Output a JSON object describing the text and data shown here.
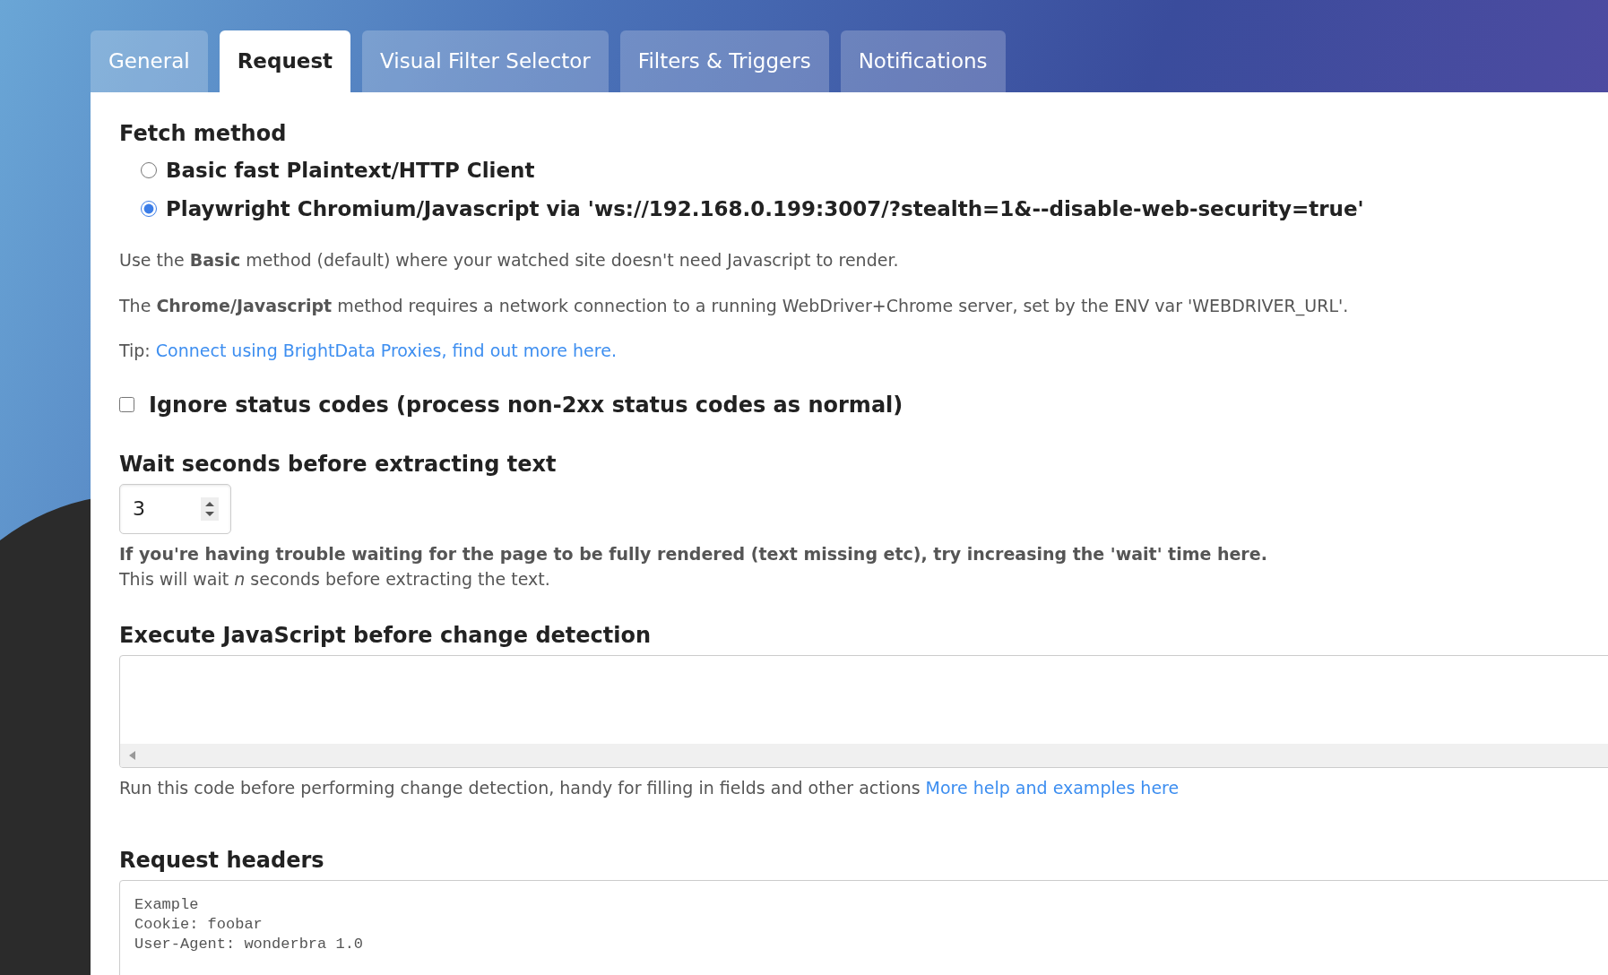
{
  "tabs": [
    {
      "label": "General",
      "selected": false
    },
    {
      "label": "Request",
      "selected": true
    },
    {
      "label": "Visual Filter Selector",
      "selected": false
    },
    {
      "label": "Filters & Triggers",
      "selected": false
    },
    {
      "label": "Notifications",
      "selected": false
    }
  ],
  "fetch_method": {
    "label": "Fetch method",
    "options": [
      {
        "label": "Basic fast Plaintext/HTTP Client",
        "selected": false
      },
      {
        "label": "Playwright Chromium/Javascript via 'ws://192.168.0.199:3007/?stealth=1&--disable-web-security=true'",
        "selected": true
      }
    ],
    "notes": [
      "Use the **Basic** method (default) where your watched site doesn't need Javascript to render.",
      "The **Chrome/Javascript** method requires a network connection to a running WebDriver+Chrome server, set by the ENV var 'WEBDRIVER_URL'."
    ],
    "tip": {
      "prefix": "Tip:",
      "link": "Connect using BrightData Proxies, find out more here."
    }
  },
  "ignore_status": {
    "label": "Ignore status codes (process non-2xx status codes as normal)",
    "checked": false
  },
  "wait": {
    "label": "Wait seconds before extracting text",
    "value": "3",
    "help_bold": "If you're having trouble waiting for the page to be fully rendered (text missing etc), try increasing the 'wait' time here.",
    "help": "This will wait *n* seconds before extracting the text."
  },
  "execute_js": {
    "label": "Execute JavaScript before change detection",
    "help": "Run this code before performing change detection, handy for filling in fields and other actions",
    "link": "More help and examples here"
  },
  "request_headers": {
    "label": "Request headers",
    "placeholder": "Example\nCookie: foobar\nUser-Agent: wonderbra 1.0"
  }
}
